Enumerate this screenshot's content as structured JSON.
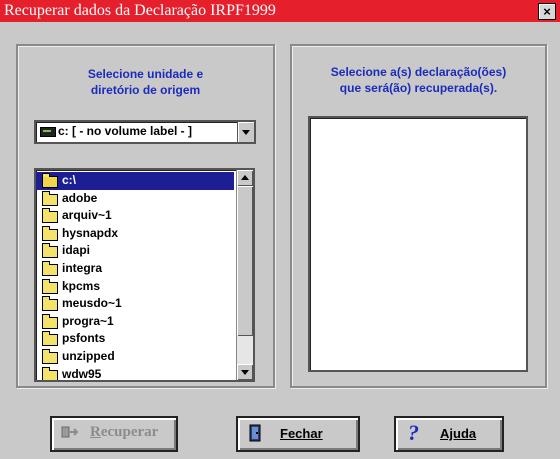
{
  "window": {
    "title": "Recuperar dados da Declaração IRPF1999",
    "close_label": "×"
  },
  "left_panel": {
    "label_line1": "Selecione unidade e",
    "label_line2": "diretório de origem",
    "drive": {
      "selected": "c: [ - no volume label - ]",
      "icon": "drive-icon"
    },
    "directories": [
      {
        "name": "c:\\",
        "selected": true
      },
      {
        "name": "adobe"
      },
      {
        "name": "arquiv~1"
      },
      {
        "name": "hysnapdx"
      },
      {
        "name": "idapi"
      },
      {
        "name": "integra"
      },
      {
        "name": "kpcms"
      },
      {
        "name": "meusdo~1"
      },
      {
        "name": "progra~1"
      },
      {
        "name": "psfonts"
      },
      {
        "name": "unzipped"
      },
      {
        "name": "wdw95"
      }
    ]
  },
  "right_panel": {
    "label_line1": "Selecione a(s) declaração(ões)",
    "label_line2": "que será(ão) recuperada(s)."
  },
  "buttons": {
    "recuperar_first": "R",
    "recuperar_rest": "ecuperar",
    "fechar": "Fechar",
    "ajuda": "Ajuda",
    "help_glyph": "?"
  },
  "colors": {
    "title_bar": "#e5202c",
    "label_text": "#1b2bbd",
    "selection": "#1e1e94"
  }
}
